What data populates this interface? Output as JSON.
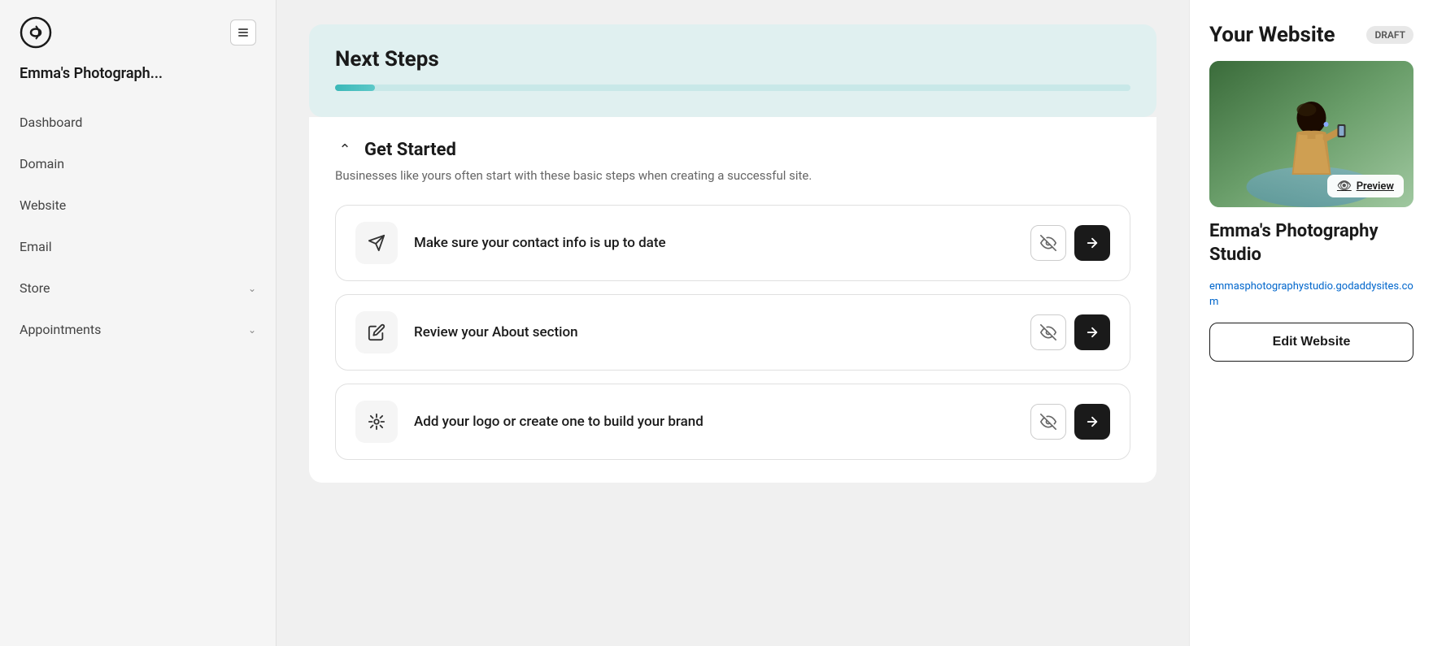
{
  "sidebar": {
    "site_name": "Emma's Photograph...",
    "nav_items": [
      {
        "label": "Dashboard",
        "has_chevron": false
      },
      {
        "label": "Domain",
        "has_chevron": false
      },
      {
        "label": "Website",
        "has_chevron": false
      },
      {
        "label": "Email",
        "has_chevron": false
      },
      {
        "label": "Store",
        "has_chevron": true
      },
      {
        "label": "Appointments",
        "has_chevron": true
      }
    ]
  },
  "main": {
    "next_steps_title": "Next Steps",
    "progress_percent": 5,
    "get_started_title": "Get Started",
    "get_started_desc": "Businesses like yours often start with these basic steps when creating a successful site.",
    "steps": [
      {
        "label": "Make sure your contact info is up to date",
        "icon": "contact"
      },
      {
        "label": "Review your About section",
        "icon": "edit"
      },
      {
        "label": "Add your logo or create one to build your brand",
        "icon": "logo"
      }
    ]
  },
  "right_panel": {
    "your_website_label": "Your Website",
    "draft_label": "DRAFT",
    "preview_label": "Preview",
    "website_name": "Emma's Photography Studio",
    "website_url": "emmasphotographystudio.godaddysites.com",
    "edit_button_label": "Edit Website"
  }
}
